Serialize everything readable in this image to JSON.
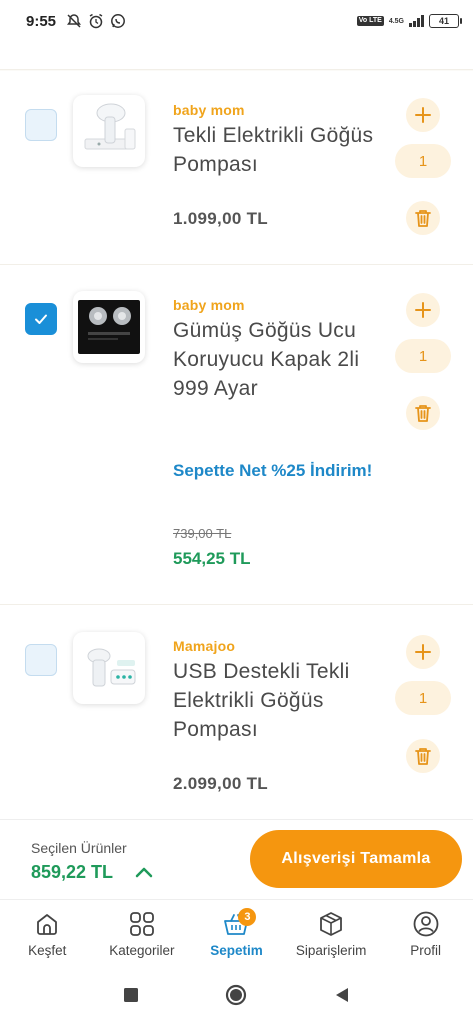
{
  "status_bar": {
    "time": "9:55",
    "network_badge": "Vo LTE",
    "network_type": "4.5G",
    "battery": "41"
  },
  "items": [
    {
      "brand": "baby mom",
      "title": "Tekli Elektrikli Göğüs Pompası",
      "price": "1.099,00 TL",
      "quantity": "1",
      "checked": false
    },
    {
      "brand": "baby mom",
      "title": "Gümüş Göğüs Ucu Koruyucu Kapak 2li 999 Ayar",
      "promo": "Sepette Net %25 İndirim!",
      "old_price": "739,00 TL",
      "price": "554,25 TL",
      "quantity": "1",
      "checked": true
    },
    {
      "brand": "Mamajoo",
      "title": "USB Destekli Tekli Elektrikli Göğüs Pompası",
      "price": "2.099,00 TL",
      "quantity": "1",
      "checked": false
    }
  ],
  "summary": {
    "label": "Seçilen Ürünler",
    "total": "859,22 TL",
    "checkout_label": "Alışverişi Tamamla"
  },
  "nav": [
    {
      "label": "Keşfet",
      "icon": "home-icon"
    },
    {
      "label": "Kategoriler",
      "icon": "grid-icon"
    },
    {
      "label": "Sepetim",
      "icon": "basket-icon",
      "active": true,
      "badge": "3"
    },
    {
      "label": "Siparişlerim",
      "icon": "box-icon"
    },
    {
      "label": "Profil",
      "icon": "user-icon"
    }
  ],
  "colors": {
    "accent": "#f5960f",
    "brand_text": "#f0a41c",
    "promo_blue": "#1e88c8",
    "discount_green": "#1f9a5a"
  }
}
